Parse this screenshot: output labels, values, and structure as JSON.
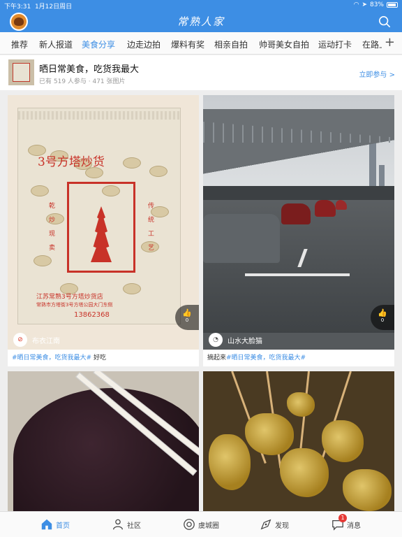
{
  "status": {
    "time": "下午3:31",
    "date": "1月12日周日",
    "battery": "83%"
  },
  "header": {
    "title": "常熟人家"
  },
  "tabs": [
    {
      "label": "推荐"
    },
    {
      "label": "新人报道"
    },
    {
      "label": "美食分享",
      "active": true
    },
    {
      "label": "边走边拍"
    },
    {
      "label": "爆料有奖"
    },
    {
      "label": "相亲自拍"
    },
    {
      "label": "帅哥美女自拍"
    },
    {
      "label": "运动打卡"
    },
    {
      "label": "在路上"
    }
  ],
  "topic": {
    "title": "晒日常美食，吃货我最大",
    "meta": "已有 519 人参与 · 471 张图片",
    "join_label": "立即参与 >"
  },
  "cards": [
    {
      "author": "布衣江南",
      "likes": "0",
      "caption_tag": "#晒日常美食，吃货我最大#",
      "caption_text": " 好吃",
      "package_text": "3号方塔炒货",
      "package_left": "乾炒现卖",
      "package_right": "传统工艺",
      "package_bottom": "江苏常熟3号方塔炒货店",
      "package_phone": "13862368",
      "package_addr": "常熟市方塔街3号方塔公园大门东侧"
    },
    {
      "author": "山水大脸猫",
      "likes": "0",
      "caption_prefix": "摘起来",
      "caption_tag": "#晒日常美食，吃货我最大#",
      "caption_text": ""
    },
    {
      "author": "",
      "likes": ""
    },
    {
      "author": "",
      "likes": ""
    }
  ],
  "bottom_nav": [
    {
      "label": "首页",
      "icon": "home-icon",
      "active": true
    },
    {
      "label": "社区",
      "icon": "community-icon"
    },
    {
      "label": "虞城圈",
      "icon": "circle-icon"
    },
    {
      "label": "发现",
      "icon": "discover-icon"
    },
    {
      "label": "消息",
      "icon": "message-icon",
      "badge": "1"
    }
  ],
  "colors": {
    "accent": "#3d8ee4",
    "badge": "#e53935"
  }
}
